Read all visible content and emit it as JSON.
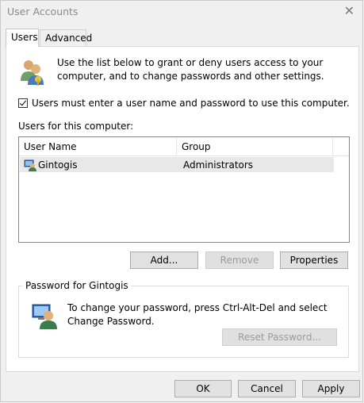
{
  "window": {
    "title": "User Accounts"
  },
  "tabs": [
    {
      "label": "Users"
    },
    {
      "label": "Advanced"
    }
  ],
  "intro": {
    "text": "Use the list below to grant or deny users access to your computer, and to change passwords and other settings."
  },
  "checkbox": {
    "label": "Users must enter a user name and password to use this computer.",
    "checked": true
  },
  "users_label": "Users for this computer:",
  "table": {
    "columns": [
      "User Name",
      "Group"
    ],
    "rows": [
      {
        "user": "Gintogis",
        "group": "Administrators"
      }
    ]
  },
  "buttons": {
    "add": "Add...",
    "remove": "Remove",
    "properties": "Properties"
  },
  "password_group": {
    "legend": "Password for Gintogis",
    "text": "To change your password, press Ctrl-Alt-Del and select Change Password.",
    "reset": "Reset Password..."
  },
  "footer": {
    "ok": "OK",
    "cancel": "Cancel",
    "apply": "Apply"
  }
}
